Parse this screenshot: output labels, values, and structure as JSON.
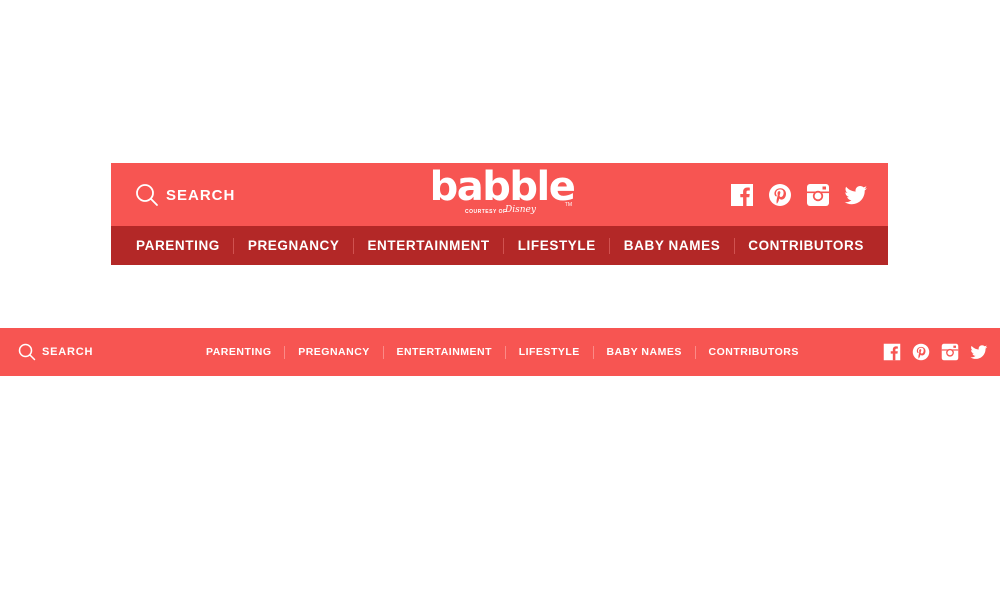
{
  "colors": {
    "brand_red": "#f75552",
    "nav_dark_red": "#b32827",
    "text": "#ffffff"
  },
  "large_header": {
    "search_label": "SEARCH",
    "logo": {
      "wordmark": "babble",
      "tagline": "COURTESY OF",
      "brand": "Disney",
      "mark": "TM"
    },
    "social_icons": [
      "facebook-icon",
      "pinterest-icon",
      "instagram-icon",
      "twitter-icon"
    ],
    "nav": [
      "PARENTING",
      "PREGNANCY",
      "ENTERTAINMENT",
      "LIFESTYLE",
      "BABY NAMES",
      "CONTRIBUTORS"
    ]
  },
  "small_header": {
    "search_label": "SEARCH",
    "nav": [
      "PARENTING",
      "PREGNANCY",
      "ENTERTAINMENT",
      "LIFESTYLE",
      "BABY NAMES",
      "CONTRIBUTORS"
    ],
    "social_icons": [
      "facebook-icon",
      "pinterest-icon",
      "instagram-icon",
      "twitter-icon"
    ]
  }
}
